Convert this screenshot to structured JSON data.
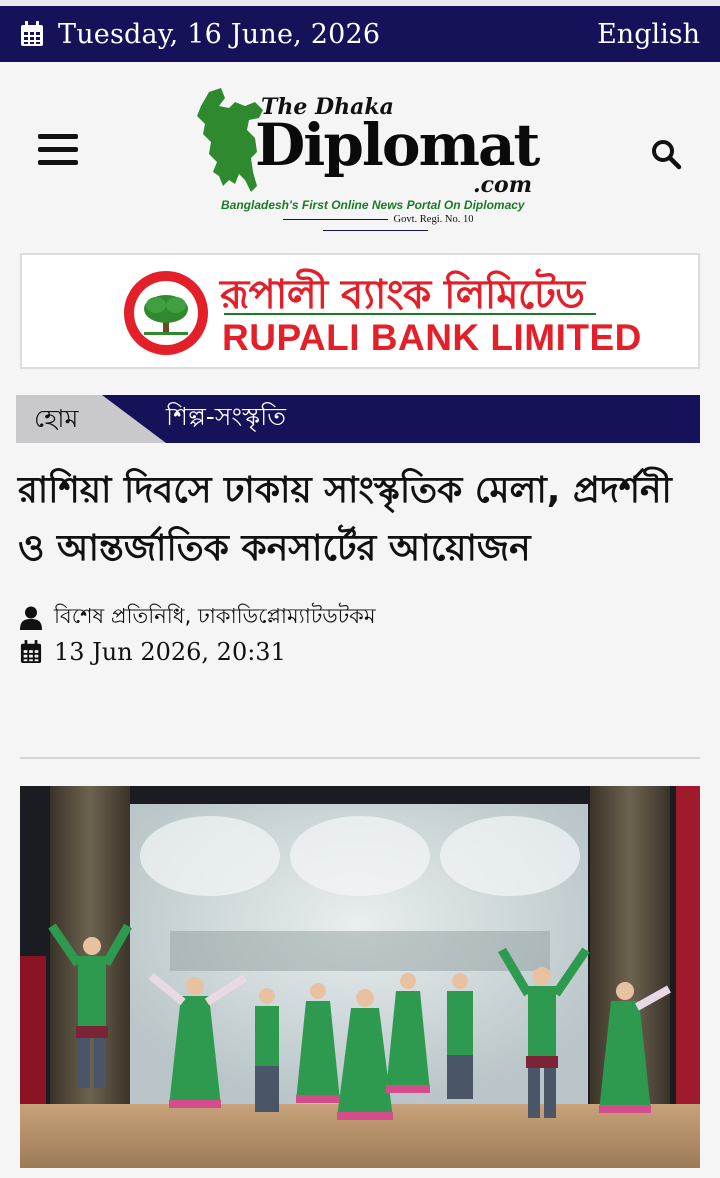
{
  "topbar": {
    "date": "Tuesday, 16 June, 2026",
    "language": "English",
    "bg_color": "#16125a"
  },
  "header": {
    "menu_icon": "hamburger-icon",
    "search_icon": "search-icon"
  },
  "logo": {
    "prefix": "The Dhaka",
    "name": "Diplomat",
    "suffix": ".com",
    "tagline": "Bangladesh's First Online News Portal On Diplomacy",
    "registration": "Govt. Regi. No. 10"
  },
  "ad": {
    "name_bn": "রূপালী ব্যাংক লিমিটেড",
    "name_en": "RUPALI BANK LIMITED",
    "brand_color": "#e3202a"
  },
  "breadcrumb": {
    "home": "হোম",
    "category": "শিল্প-সংস্কৃতি"
  },
  "article": {
    "title": "রাশিয়া দিবসে ঢাকায় সাংস্কৃতিক মেলা, প্রদর্শনী ও আন্তর্জাতিক কনসার্টের আয়োজন",
    "author": "বিশেষ প্রতিনিধি, ঢাকাডিপ্লোম্যাটডটকম",
    "published": "13 Jun 2026, 20:31"
  }
}
